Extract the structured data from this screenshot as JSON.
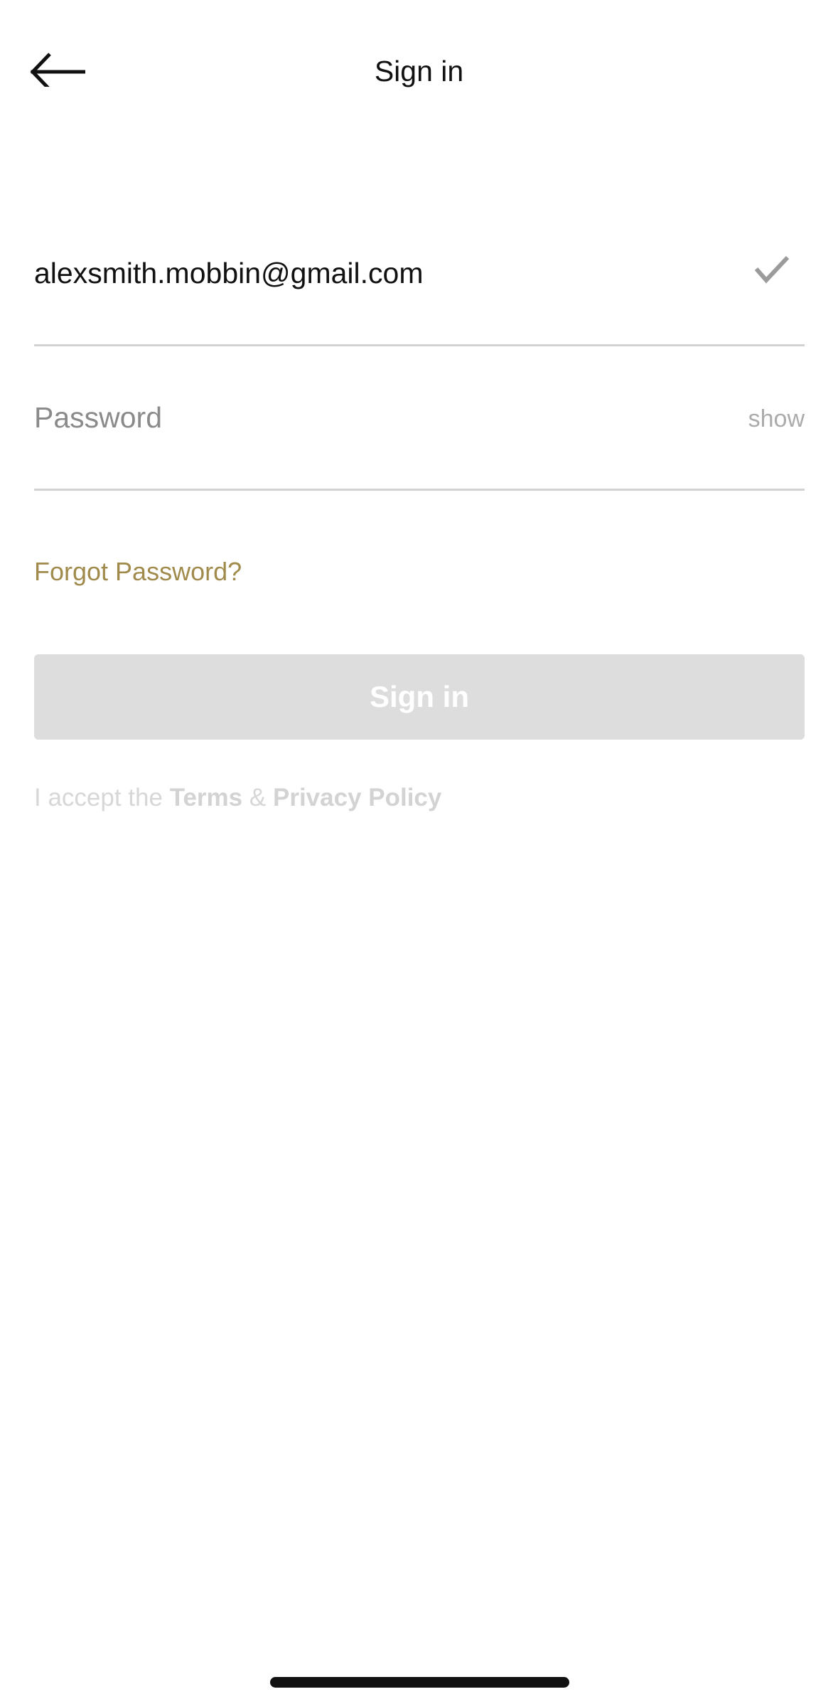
{
  "header": {
    "title": "Sign in",
    "back_icon": "arrow-left-icon"
  },
  "email": {
    "value": "alexsmith.mobbin@gmail.com",
    "status_icon": "checkmark-icon"
  },
  "password": {
    "placeholder": "Password",
    "value": "",
    "toggle_label": "show"
  },
  "forgot_password": "Forgot Password?",
  "sign_in_button": "Sign in",
  "terms": {
    "prefix": "I accept the",
    "terms_link": "Terms",
    "separator": "&",
    "privacy_link": "Privacy Policy"
  },
  "colors": {
    "accent": "#a08a4c",
    "button_disabled": "#dddddd",
    "divider": "#d2d2d2"
  }
}
